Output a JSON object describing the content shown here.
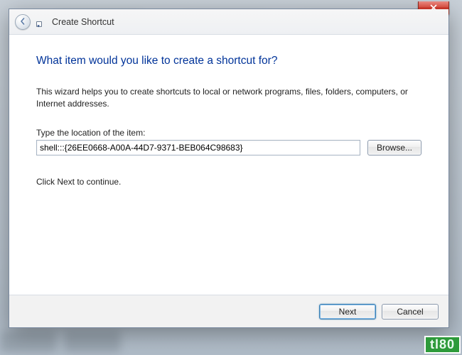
{
  "window": {
    "title": "Create Shortcut"
  },
  "wizard": {
    "heading": "What item would you like to create a shortcut for?",
    "description": "This wizard helps you to create shortcuts to local or network programs, files, folders, computers, or Internet addresses.",
    "location_label": "Type the location of the item:",
    "location_value": "shell:::{26EE0668-A00A-44D7-9371-BEB064C98683}",
    "browse_label": "Browse...",
    "continue_hint": "Click Next to continue."
  },
  "buttons": {
    "next": "Next",
    "cancel": "Cancel"
  },
  "watermark": "tl80"
}
